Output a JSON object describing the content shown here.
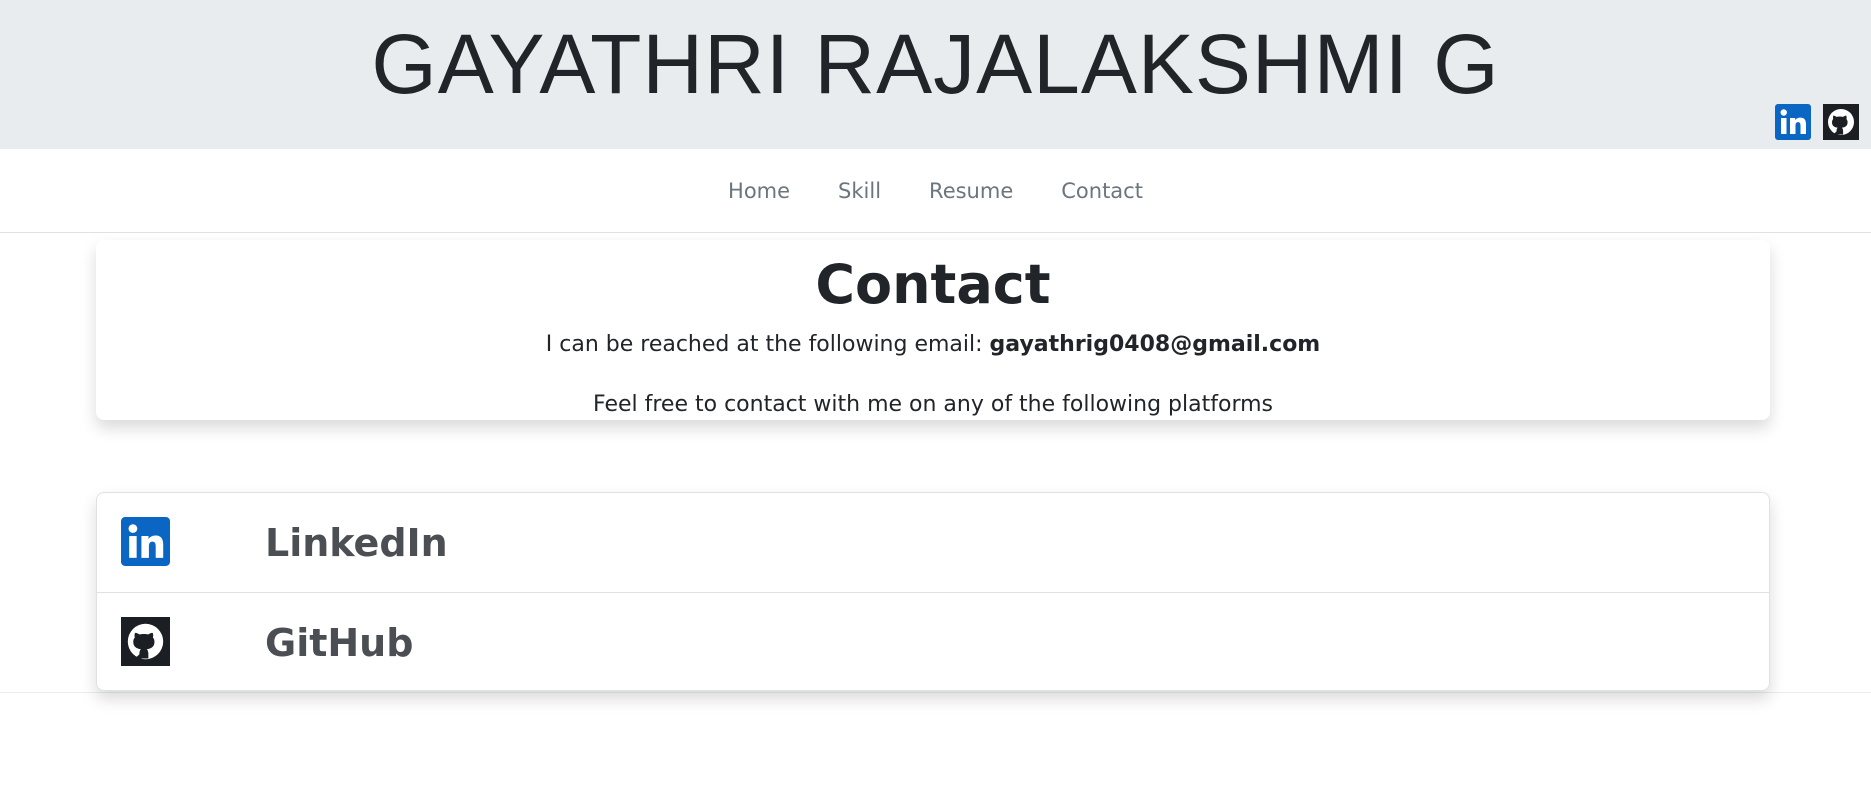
{
  "header": {
    "title": "GAYATHRI RAJALAKSHMI G",
    "icons": [
      {
        "name": "linkedin-icon",
        "color": "#0a66c2"
      },
      {
        "name": "github-icon",
        "color": "#1b1f23"
      }
    ]
  },
  "nav": {
    "items": [
      {
        "label": "Home"
      },
      {
        "label": "Skill"
      },
      {
        "label": "Resume"
      },
      {
        "label": "Contact"
      }
    ]
  },
  "contact": {
    "heading": "Contact",
    "email_prefix": "I can be reached at the following email: ",
    "email": "gayathrig0408@gmail.com",
    "platforms_text": "Feel free to contact with me on any of the following platforms"
  },
  "platforms": [
    {
      "label": "LinkedIn",
      "icon": "linkedin-icon"
    },
    {
      "label": "GitHub",
      "icon": "github-icon"
    }
  ],
  "colors": {
    "header_bg": "#e9ecef",
    "nav_link": "#6c757d",
    "linkedin": "#0a66c2",
    "github": "#1b1f23"
  }
}
